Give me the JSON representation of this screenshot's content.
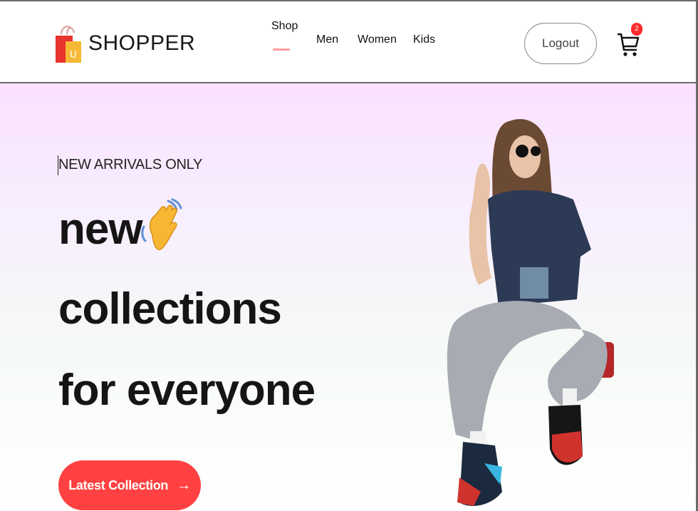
{
  "brand": {
    "name": "SHOPPER",
    "icon": "shopping-bag-icon"
  },
  "nav": {
    "items": [
      {
        "label": "Shop",
        "active": true
      },
      {
        "label": "Men"
      },
      {
        "label": "Women"
      },
      {
        "label": "Kids"
      }
    ],
    "logout_label": "Logout",
    "cart_count": "2"
  },
  "hero": {
    "eyebrow": "NEW ARRIVALS ONLY",
    "line1": "new",
    "line2": "collections",
    "line3": "for everyone",
    "wave_icon": "waving-hand-icon",
    "cta_label": "Latest Collection",
    "cta_icon": "arrow-right-icon"
  },
  "colors": {
    "accent": "#ff4141",
    "badge": "#ff2a2a",
    "hero_top": "#fbe1ff",
    "hero_bottom": "#ffffff"
  }
}
